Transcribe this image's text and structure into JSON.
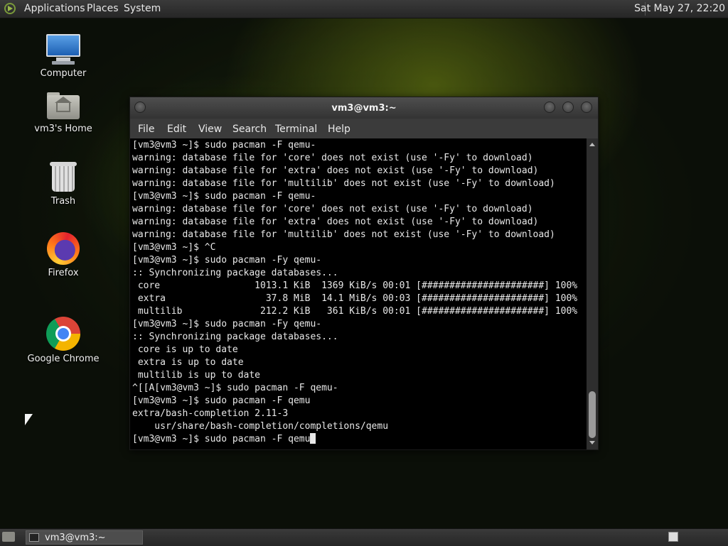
{
  "top_panel": {
    "menus": [
      "Applications",
      "Places",
      "System"
    ],
    "clock": "Sat May 27, 22:20"
  },
  "desktop_icons": [
    {
      "label": "Computer",
      "icon": "computer-icon"
    },
    {
      "label": "vm3's Home",
      "icon": "home-folder-icon"
    },
    {
      "label": "Trash",
      "icon": "trash-icon"
    },
    {
      "label": "Firefox",
      "icon": "firefox-icon"
    },
    {
      "label": "Google Chrome",
      "icon": "chrome-icon"
    }
  ],
  "terminal": {
    "title": "vm3@vm3:~",
    "menus": [
      "File",
      "Edit",
      "View",
      "Search",
      "Terminal",
      "Help"
    ],
    "lines": [
      "[vm3@vm3 ~]$ sudo pacman -F qemu-",
      "warning: database file for 'core' does not exist (use '-Fy' to download)",
      "warning: database file for 'extra' does not exist (use '-Fy' to download)",
      "warning: database file for 'multilib' does not exist (use '-Fy' to download)",
      "[vm3@vm3 ~]$ sudo pacman -F qemu-",
      "warning: database file for 'core' does not exist (use '-Fy' to download)",
      "warning: database file for 'extra' does not exist (use '-Fy' to download)",
      "warning: database file for 'multilib' does not exist (use '-Fy' to download)",
      "[vm3@vm3 ~]$ ^C",
      "[vm3@vm3 ~]$ sudo pacman -Fy qemu-",
      ":: Synchronizing package databases...",
      " core                 1013.1 KiB  1369 KiB/s 00:01 [######################] 100%",
      " extra                  37.8 MiB  14.1 MiB/s 00:03 [######################] 100%",
      " multilib              212.2 KiB   361 KiB/s 00:01 [######################] 100%",
      "[vm3@vm3 ~]$ sudo pacman -Fy qemu-",
      ":: Synchronizing package databases...",
      " core is up to date",
      " extra is up to date",
      " multilib is up to date",
      "^[[A[vm3@vm3 ~]$ sudo pacman -F qemu-",
      "[vm3@vm3 ~]$ sudo pacman -F qemu",
      "extra/bash-completion 2.11-3",
      "    usr/share/bash-completion/completions/qemu"
    ],
    "prompt_line": "[vm3@vm3 ~]$ sudo pacman -F qemu"
  },
  "taskbar": {
    "task_label": "vm3@vm3:~"
  }
}
